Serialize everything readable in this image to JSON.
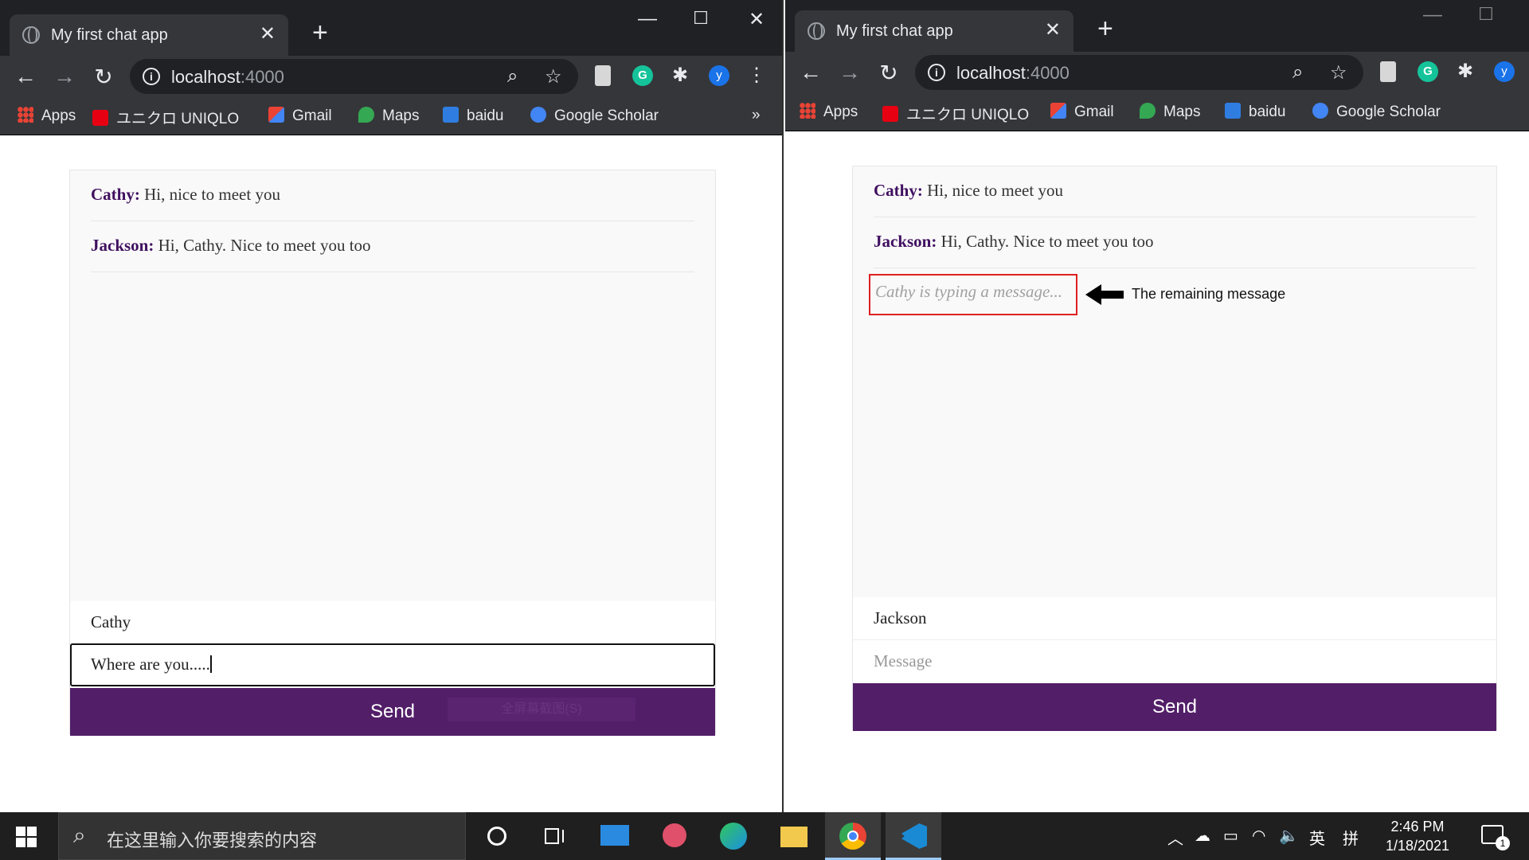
{
  "left_window": {
    "tab_title": "My first chat app",
    "url_host": "localhost",
    "url_port": ":4000",
    "profile_initial": "y",
    "bookmarks": [
      "Apps",
      "ユニクロ UNIQLO",
      "Gmail",
      "Maps",
      "baidu",
      "Google Scholar"
    ],
    "bookmarks_overflow": "»",
    "messages": [
      {
        "author": "Cathy:",
        "text": " Hi, nice to meet you"
      },
      {
        "author": "Jackson:",
        "text": " Hi, Cathy. Nice to meet you too"
      }
    ],
    "name_value": "Cathy",
    "message_value": "Where are you.....",
    "send_label": "Send",
    "send_overlay_text": "全屏幕截图(S)"
  },
  "right_window": {
    "tab_title": "My first chat app",
    "url_host": "localhost",
    "url_port": ":4000",
    "profile_initial": "y",
    "bookmarks": [
      "Apps",
      "ユニクロ UNIQLO",
      "Gmail",
      "Maps",
      "baidu",
      "Google Scholar"
    ],
    "messages": [
      {
        "author": "Cathy:",
        "text": " Hi, nice to meet you"
      },
      {
        "author": "Jackson:",
        "text": " Hi, Cathy. Nice to meet you too"
      }
    ],
    "typing_indicator": "Cathy is typing a message...",
    "annotation": "The remaining message",
    "name_value": "Jackson",
    "message_placeholder": "Message",
    "send_label": "Send"
  },
  "taskbar": {
    "search_placeholder": "在这里输入你要搜索的内容",
    "tray_lang": "英",
    "tray_ime": "拼",
    "time": "2:46 PM",
    "date": "1/18/2021",
    "notification_count": "1"
  },
  "colors": {
    "send_button": "#521e68",
    "author_name": "#401060",
    "typing_border": "#e02020",
    "chrome_dark": "#202124",
    "chrome_toolbar": "#35363a"
  }
}
